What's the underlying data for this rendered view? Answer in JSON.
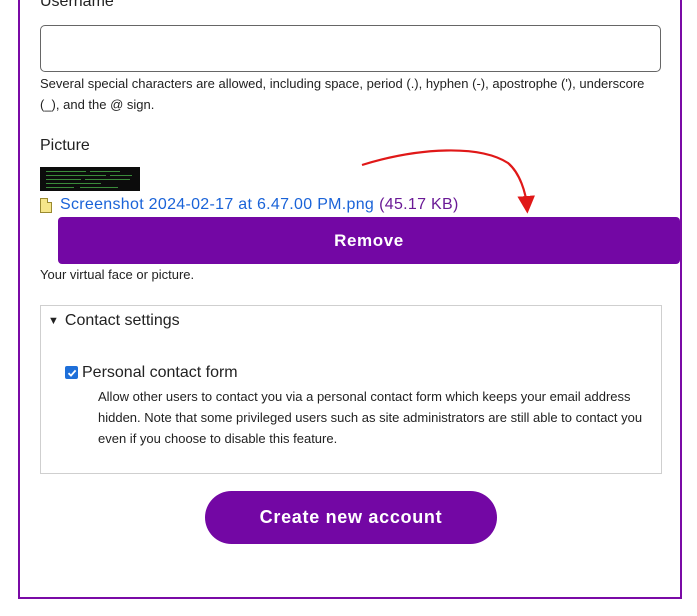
{
  "form": {
    "username": {
      "label": "Username",
      "required_mark": "*",
      "value": "",
      "help": "Several special characters are allowed, including space, period (.), hyphen (-), apostrophe ('), underscore (_), and the @ sign."
    },
    "picture": {
      "label": "Picture",
      "file_name": "Screenshot 2024-02-17 at 6.47.00 PM.png",
      "file_size": "(45.17 KB)",
      "remove_label": "Remove",
      "help": "Your virtual face or picture."
    },
    "contact": {
      "summary": "Contact settings",
      "expanded": true,
      "checkbox_label": "Personal contact form",
      "checked": true,
      "description": "Allow other users to contact you via a personal contact form which keeps your email address hidden. Note that some privileged users such as site administrators are still able to contact you even if you choose to disable this feature."
    },
    "submit_label": "Create new account"
  },
  "colors": {
    "button": "#7307a4",
    "link": "#1a63d8",
    "annotation_arrow": "#e01818"
  },
  "icons": {
    "summary_toggle": "triangle-down",
    "file": "image-file-icon"
  }
}
